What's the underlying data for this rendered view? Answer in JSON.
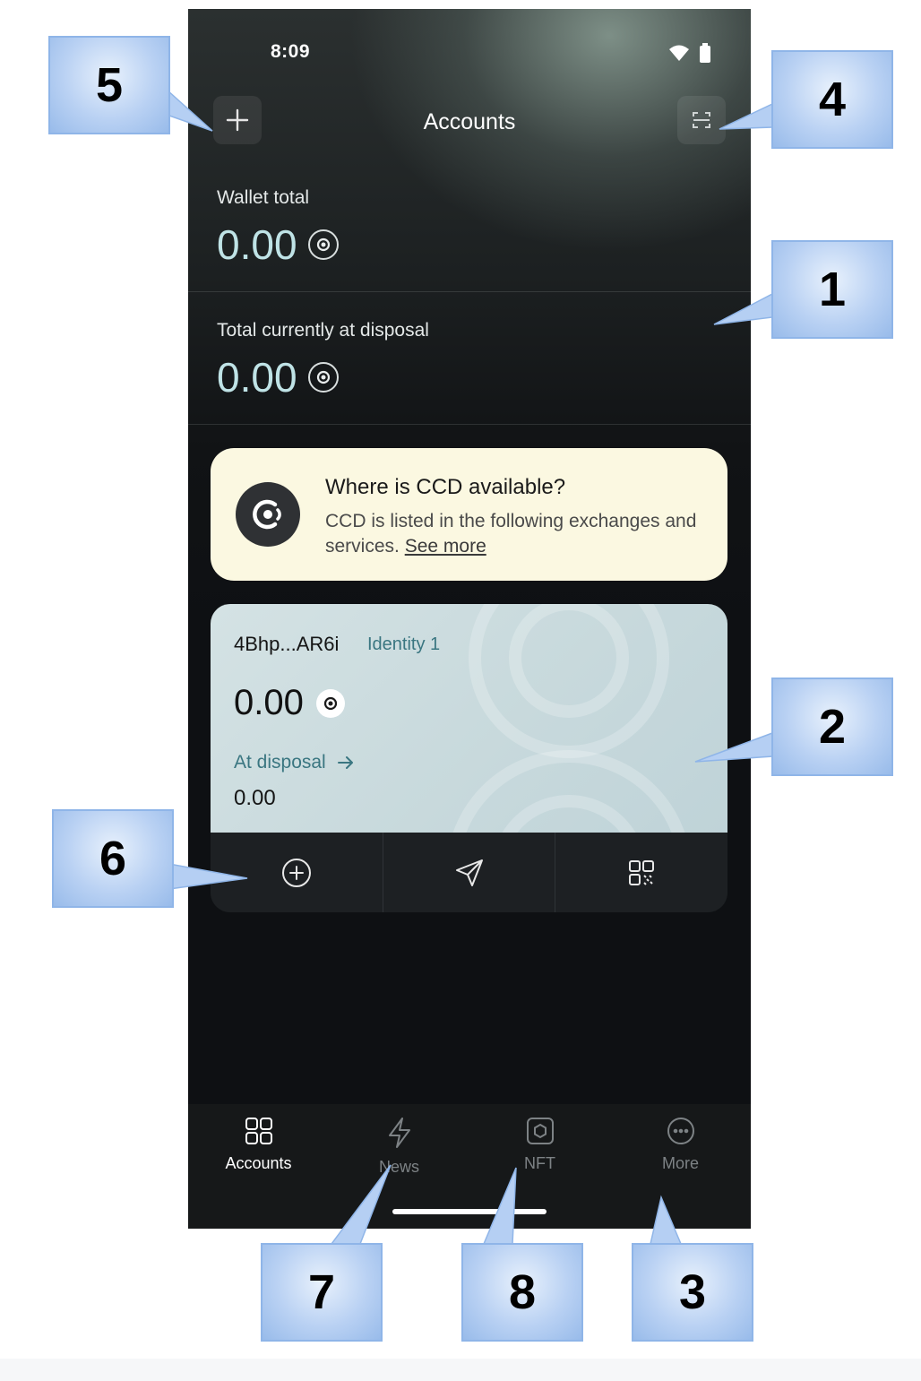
{
  "status_bar": {
    "time": "8:09"
  },
  "header": {
    "title": "Accounts"
  },
  "summary": {
    "wallet_total_label": "Wallet total",
    "wallet_total_value": "0.00",
    "disposal_label": "Total currently at disposal",
    "disposal_value": "0.00"
  },
  "promo": {
    "title": "Where is CCD available?",
    "text": "CCD is listed in the following exchanges and services.",
    "link": "See more"
  },
  "account": {
    "address": "4Bhp...AR6i",
    "identity": "Identity 1",
    "balance": "0.00",
    "disposal_label": "At disposal",
    "disposal_value": "0.00"
  },
  "nav": [
    {
      "label": "Accounts",
      "icon": "grid-icon"
    },
    {
      "label": "News",
      "icon": "lightning-icon"
    },
    {
      "label": "NFT",
      "icon": "nft-icon"
    },
    {
      "label": "More",
      "icon": "more-icon"
    }
  ],
  "callouts": [
    "5",
    "4",
    "1",
    "2",
    "6",
    "7",
    "8",
    "3"
  ],
  "colors": {
    "accent": "#3a7681",
    "balance": "#bfe3e6",
    "promo_bg": "#fbf8e1",
    "callout": "#b9d1f3"
  }
}
